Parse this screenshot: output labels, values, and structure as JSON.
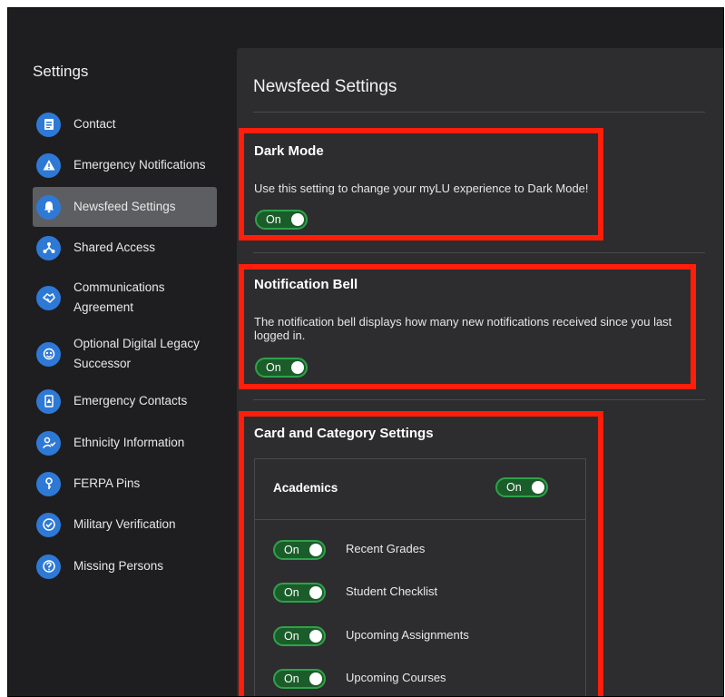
{
  "sidebar": {
    "title": "Settings",
    "items": [
      {
        "label": "Contact",
        "icon": "contact-card-icon"
      },
      {
        "label": "Emergency Notifications",
        "icon": "warning-icon"
      },
      {
        "label": "Newsfeed Settings",
        "icon": "bell-icon",
        "active": true
      },
      {
        "label": "Shared Access",
        "icon": "share-icon"
      },
      {
        "label": "Communications Agreement",
        "icon": "handshake-icon"
      },
      {
        "label": "Optional Digital Legacy Successor",
        "icon": "legacy-icon"
      },
      {
        "label": "Emergency Contacts",
        "icon": "emergency-contacts-icon"
      },
      {
        "label": "Ethnicity Information",
        "icon": "user-check-icon"
      },
      {
        "label": "FERPA Pins",
        "icon": "pin-icon"
      },
      {
        "label": "Military Verification",
        "icon": "verified-icon"
      },
      {
        "label": "Missing Persons",
        "icon": "question-icon"
      }
    ]
  },
  "main": {
    "title": "Newsfeed Settings",
    "dark_mode": {
      "title": "Dark Mode",
      "description": "Use this setting to change your myLU experience to Dark Mode!",
      "toggle": "On"
    },
    "notification_bell": {
      "title": "Notification Bell",
      "description": "The notification bell displays how many new notifications received since you last logged in.",
      "toggle": "On"
    },
    "card_category": {
      "title": "Card and Category Settings",
      "academics": {
        "label": "Academics",
        "toggle": "On"
      },
      "rows": [
        {
          "label": "Recent Grades",
          "toggle": "On"
        },
        {
          "label": "Student Checklist",
          "toggle": "On"
        },
        {
          "label": "Upcoming Assignments",
          "toggle": "On"
        },
        {
          "label": "Upcoming Courses",
          "toggle": "On"
        }
      ]
    }
  },
  "colors": {
    "background": "#1e1e20",
    "panel": "#2d2d2f",
    "accent_blue": "#2e79d6",
    "toggle_on": "#2fa14a",
    "highlight_red": "#ff1e0a",
    "active_item": "#5d5e61"
  }
}
